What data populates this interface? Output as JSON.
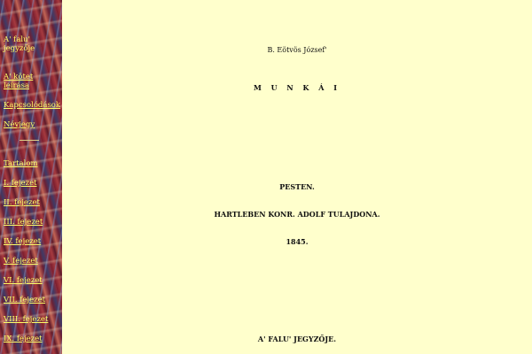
{
  "sidebar": {
    "title": "A' falu' jegyzője",
    "items": [
      "A' kötet leírása",
      "Kapcsolódások",
      "Névjegy",
      "Tartalom",
      "I. fejezet",
      "II. fejezet",
      "III. fejezet",
      "IV. fejezet",
      "V. fejezet",
      "VI. fejezet",
      "VII. fejezet",
      "VIII. fejezet",
      "IX. fejezet"
    ]
  },
  "main": {
    "author": "B. Eötvös József'",
    "works": "M U N K Á I",
    "place": "PESTEN.",
    "publisher": "HARTLEBEN KONR. ADOLF TULAJDONA.",
    "year": "1845.",
    "book_title": "A' FALU' JEGYZŐJE."
  },
  "colors": {
    "page_background": "#ffffcc",
    "sidebar_link": "#ffff66",
    "text": "#111111"
  }
}
